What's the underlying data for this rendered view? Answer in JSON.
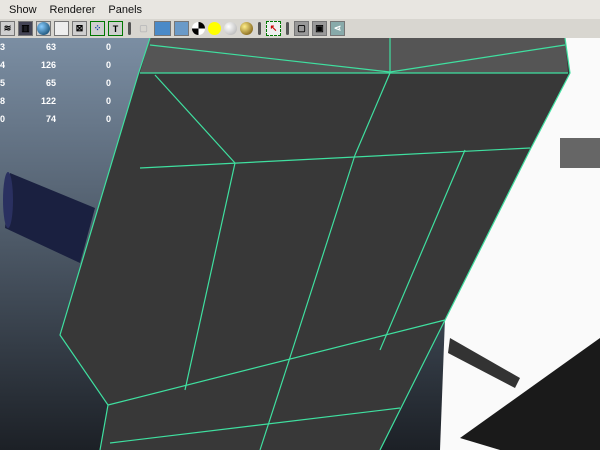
{
  "menu": [
    "Show",
    "Renderer",
    "Panels"
  ],
  "toolbar_icons": [
    "layers-icon",
    "film-gate-icon",
    "shaded-sphere-icon",
    "xray-icon",
    "grid-icon",
    "uv-icon",
    "text-icon",
    "separator",
    "wireframe-cube-icon",
    "smooth-shade-icon",
    "flat-shade-icon",
    "checker-icon",
    "light-icon",
    "default-material-icon",
    "gold-material-icon",
    "separator",
    "select-region-icon",
    "separator",
    "isolate-icon",
    "frame-icon",
    "share-icon"
  ],
  "stats": [
    {
      "a": "3",
      "b": "63",
      "c": "0"
    },
    {
      "a": "4",
      "b": "126",
      "c": "0"
    },
    {
      "a": "5",
      "b": "65",
      "c": "0"
    },
    {
      "a": "8",
      "b": "122",
      "c": "0"
    },
    {
      "a": "0",
      "b": "74",
      "c": "0"
    }
  ],
  "colors": {
    "wire": "#3fe0a0",
    "mesh": "#383838",
    "top_face": "#555555"
  }
}
